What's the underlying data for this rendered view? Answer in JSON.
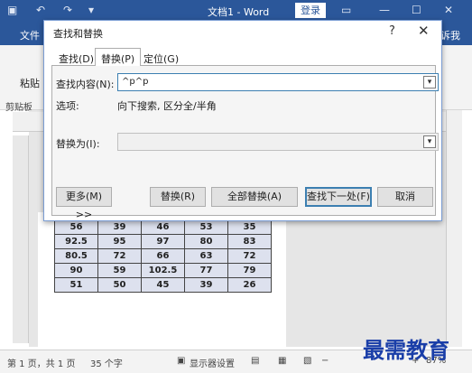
{
  "window": {
    "title": "文档1 - Word",
    "login_label": "登录"
  },
  "ribbon": {
    "file_tab": "文件",
    "right_tab_partial": "诉我",
    "paste_label": "粘贴",
    "clipboard_label": "剪贴板"
  },
  "dialog": {
    "title": "查找和替换",
    "help": "?",
    "close": "✕",
    "tabs": [
      "查找(D)",
      "替换(P)",
      "定位(G)"
    ],
    "active_tab": 1,
    "find_label": "查找内容(N):",
    "find_value": "^p^p",
    "options_label": "选项:",
    "options_value": "向下搜索, 区分全/半角",
    "replace_label": "替换为(I):",
    "replace_value": "",
    "buttons": {
      "more": "更多(M) >>",
      "replace": "替换(R)",
      "replace_all": "全部替换(A)",
      "find_next": "查找下一处(F)",
      "cancel": "取消"
    }
  },
  "table": {
    "rows": [
      [
        "56",
        "39",
        "46",
        "53",
        "35"
      ],
      [
        "92.5",
        "95",
        "97",
        "80",
        "83"
      ],
      [
        "80.5",
        "72",
        "66",
        "63",
        "72"
      ],
      [
        "90",
        "59",
        "102.5",
        "77",
        "79"
      ],
      [
        "51",
        "50",
        "45",
        "39",
        "26"
      ]
    ]
  },
  "status": {
    "page": "第 1 页，共 1 页",
    "words": "35 个字",
    "display": "显示器设置",
    "zoom": "87%"
  },
  "watermark": "最需教育"
}
